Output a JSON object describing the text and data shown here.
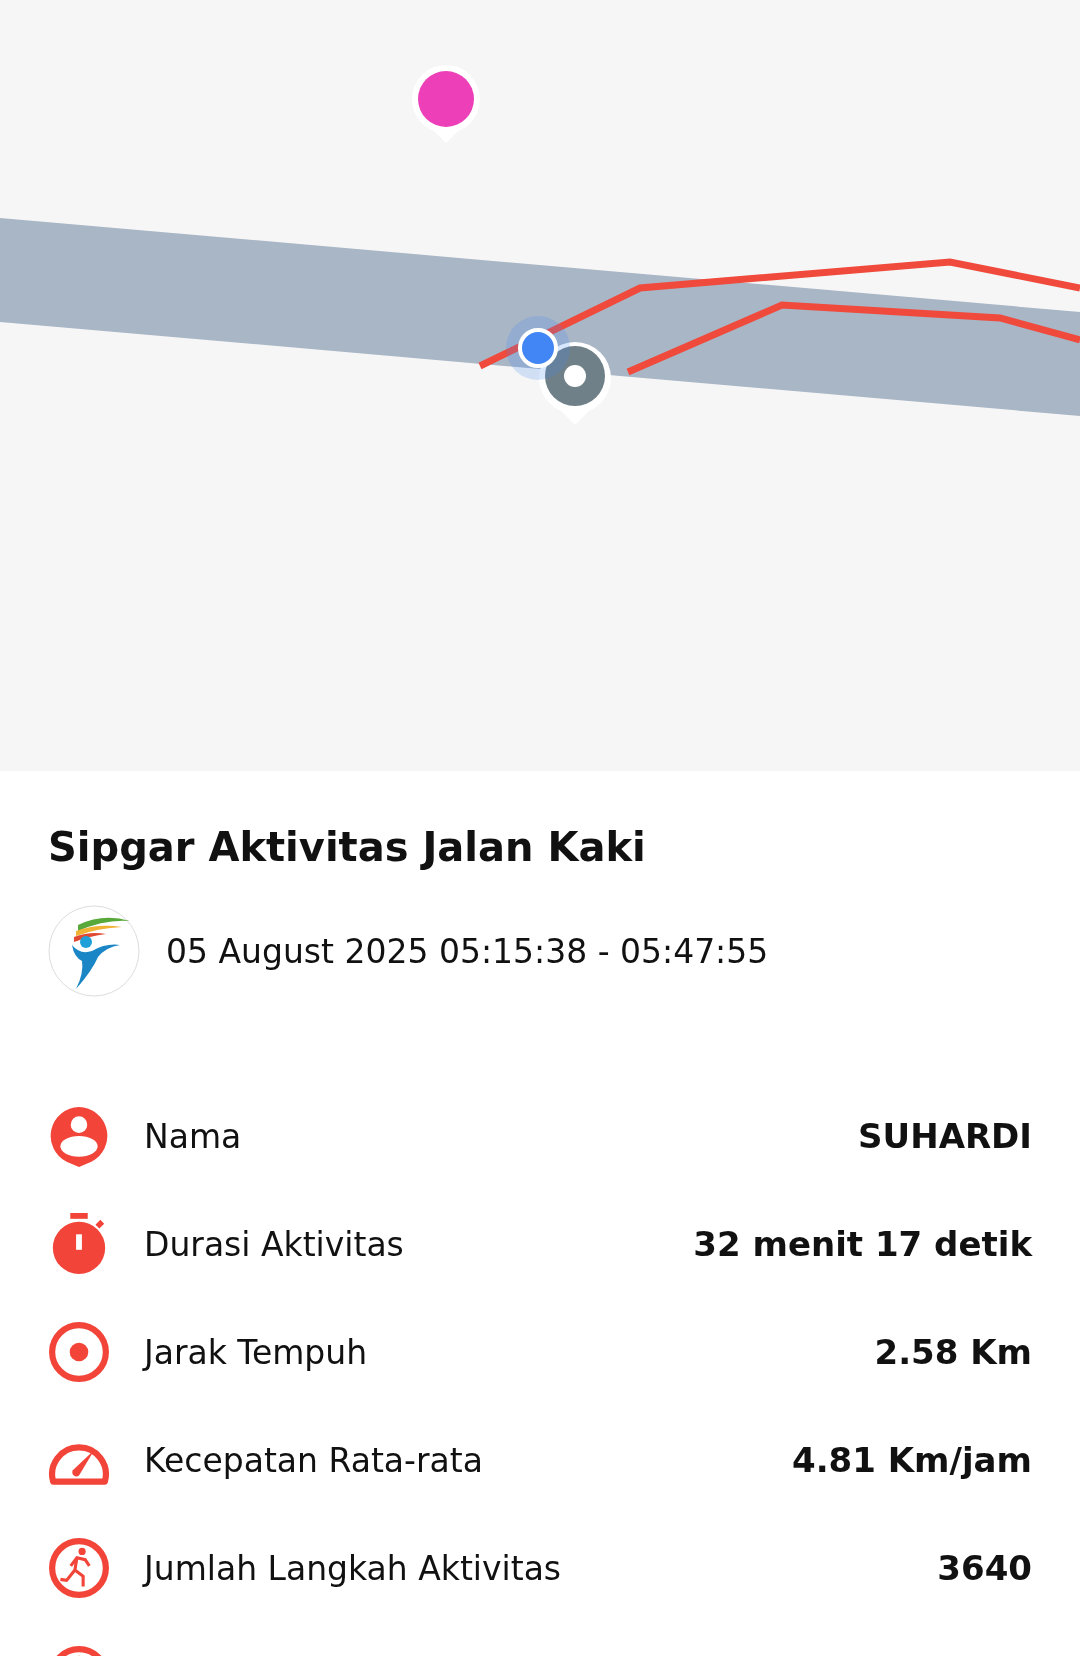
{
  "activity": {
    "title": "Sipgar Aktivitas Jalan Kaki",
    "datetime": "05 August 2025 05:15:38 - 05:47:55"
  },
  "stats": [
    {
      "kind": "person",
      "label": "Nama",
      "value": "SUHARDI"
    },
    {
      "kind": "stopwatch",
      "label": "Durasi Aktivitas",
      "value": "32 menit 17 detik"
    },
    {
      "kind": "target",
      "label": "Jarak Tempuh",
      "value": "2.58 Km"
    },
    {
      "kind": "speed",
      "label": "Kecepatan Rata-rata",
      "value": "4.81 Km/jam"
    },
    {
      "kind": "walker",
      "label": "Jumlah Langkah Aktivitas",
      "value": "3640"
    },
    {
      "kind": "partial"
    }
  ]
}
